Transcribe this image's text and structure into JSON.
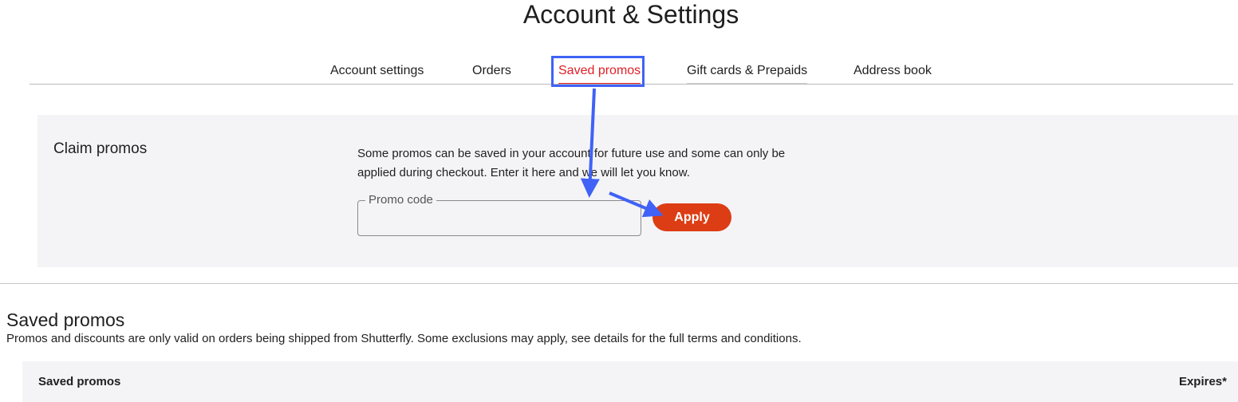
{
  "header": {
    "title": "Account & Settings"
  },
  "tabs": [
    {
      "label": "Account settings",
      "active": false
    },
    {
      "label": "Orders",
      "active": false
    },
    {
      "label": "Saved promos",
      "active": true
    },
    {
      "label": "Gift cards & Prepaids",
      "active": false
    },
    {
      "label": "Address book",
      "active": false
    }
  ],
  "claim": {
    "title": "Claim promos",
    "description": "Some promos can be saved in your account for future use and some can only be applied during checkout. Enter it here and we will let you know.",
    "promo_field": {
      "label": "Promo code",
      "value": ""
    },
    "apply_label": "Apply"
  },
  "saved": {
    "title": "Saved promos",
    "note": "Promos and discounts are only valid on orders being shipped from Shutterfly. Some exclusions may apply, see details for the full terms and conditions.",
    "columns": [
      "Saved promos",
      "Expires*"
    ]
  },
  "colors": {
    "accent": "#e11e26",
    "apply_button": "#dd3d14",
    "annotation": "#4062f6",
    "panel_bg": "#f4f4f6"
  }
}
